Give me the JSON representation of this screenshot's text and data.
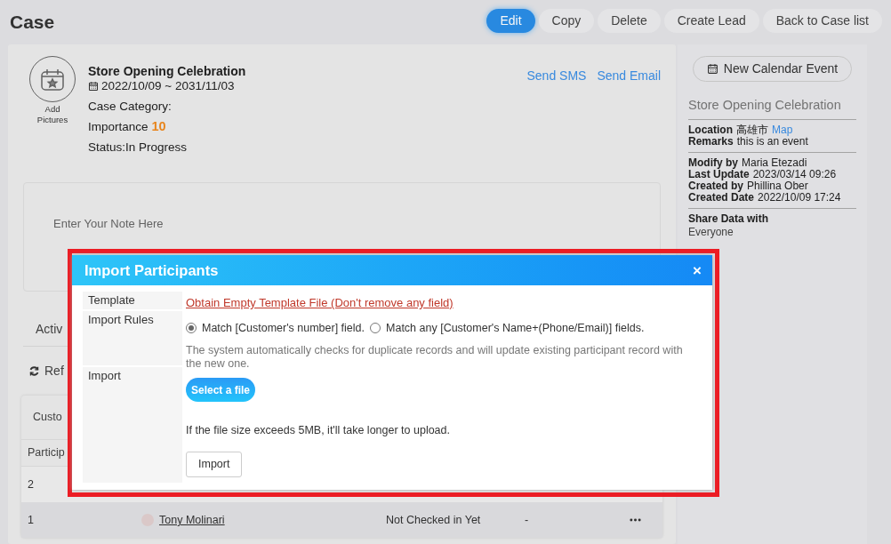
{
  "page": {
    "title": "Case"
  },
  "actions": [
    {
      "label": "Edit",
      "primary": true
    },
    {
      "label": "Copy",
      "primary": false
    },
    {
      "label": "Delete",
      "primary": false
    },
    {
      "label": "Create Lead",
      "primary": false
    },
    {
      "label": "Back to Case list",
      "primary": false
    }
  ],
  "case": {
    "add_pictures": "Add Pictures",
    "title": "Store Opening Celebration",
    "date_range": "2022/10/09 ~ 2031/11/03",
    "category": "Case Category:",
    "importance_label": "Importance",
    "importance": "10",
    "status": "Status:In Progress"
  },
  "links": [
    "Send SMS",
    "Send Email"
  ],
  "note": {
    "placeholder": "Enter Your Note Here"
  },
  "section_tab": "Activ",
  "refresh": "Ref",
  "table": {
    "header": "Custo",
    "group_label": "Particip",
    "rows": [
      {
        "number": "2",
        "highlighted": false
      },
      {
        "number": "1",
        "name": "Tony Molinari",
        "status": "Not Checked in Yet",
        "column_4": "-",
        "highlighted": true
      }
    ]
  },
  "sidebar": {
    "button": "New Calendar Event",
    "title": "Store Opening Celebration",
    "groups": [
      [
        {
          "label": "Location",
          "value": "高雄市",
          "link": "Map"
        },
        {
          "label": "Remarks",
          "value": "this is an event"
        }
      ],
      [
        {
          "label": "Modify by",
          "value": "Maria Etezadi"
        },
        {
          "label": "Last Update",
          "value": "2023/03/14 09:26"
        },
        {
          "label": "Created by",
          "value": "Phillina Ober"
        },
        {
          "label": "Created Date",
          "value": "2022/10/09 17:24"
        }
      ]
    ],
    "share_label": "Share Data with",
    "share_value": "Everyone"
  },
  "modal": {
    "title": "Import Participants",
    "close": "×",
    "rows": [
      {
        "label": "Template",
        "kind": "link",
        "text": "Obtain Empty Template File (Don't remove any field)"
      },
      {
        "label": "Import Rules",
        "kind": "rules",
        "options": [
          {
            "label": "Match [Customer's number] field.",
            "selected": true
          },
          {
            "label": "Match any [Customer's Name+(Phone/Email)] fields.",
            "selected": false
          }
        ],
        "note": "The system automatically checks for duplicate records and will update existing participant record with the new one."
      },
      {
        "label": "Import",
        "kind": "import",
        "select_button": "Select a file",
        "note": "If the file size exceeds 5MB, it'll take longer to upload.",
        "button": "Import"
      }
    ]
  }
}
